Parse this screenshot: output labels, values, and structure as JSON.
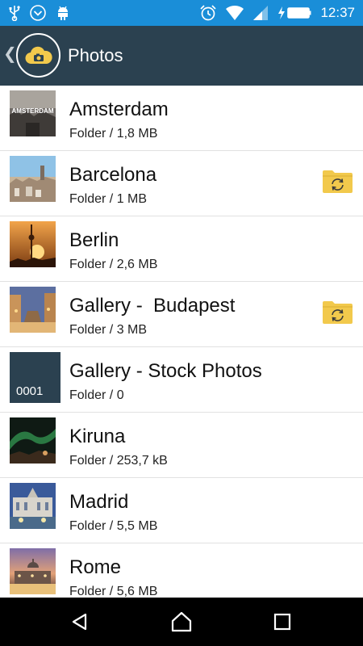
{
  "status_bar": {
    "time": "12:37",
    "left_icons": [
      "usb-icon",
      "download-circle-icon",
      "android-icon"
    ],
    "right_icons": [
      "alarm-icon",
      "wifi-icon",
      "signal-icon",
      "charging-battery-icon"
    ]
  },
  "app_bar": {
    "title": "Photos",
    "logo_icon": "cloud-camera-icon"
  },
  "folders": [
    {
      "name": "Amsterdam",
      "info": "Folder / 1,8 MB",
      "thumbnail": "amsterdam-photo",
      "synced": false
    },
    {
      "name": "Barcelona",
      "info": "Folder / 1 MB",
      "thumbnail": "barcelona-photo",
      "synced": true
    },
    {
      "name": "Berlin",
      "info": "Folder / 2,6 MB",
      "thumbnail": "berlin-photo",
      "synced": false
    },
    {
      "name": "Gallery -  Budapest",
      "info": "Folder / 3 MB",
      "thumbnail": "budapest-photo",
      "synced": true
    },
    {
      "name": "Gallery - Stock Photos",
      "info": "Folder / 0",
      "thumbnail_text": "0001",
      "synced": false
    },
    {
      "name": "Kiruna",
      "info": "Folder / 253,7 kB",
      "thumbnail": "kiruna-photo",
      "synced": false
    },
    {
      "name": "Madrid",
      "info": "Folder / 5,5 MB",
      "thumbnail": "madrid-photo",
      "synced": false
    },
    {
      "name": "Rome",
      "info": "Folder / 5,6 MB",
      "thumbnail": "rome-photo",
      "synced": false
    }
  ],
  "thumbnail_text": {
    "amsterdam": "AMSTERDAM"
  },
  "nav_bar": {
    "icons": [
      "back-triangle-icon",
      "home-icon",
      "recents-icon"
    ]
  },
  "colors": {
    "status_bar": "#1a8ed8",
    "app_bar": "#2b4150",
    "sync_folder": "#f2c94c",
    "logo_cloud": "#f2c94c"
  }
}
